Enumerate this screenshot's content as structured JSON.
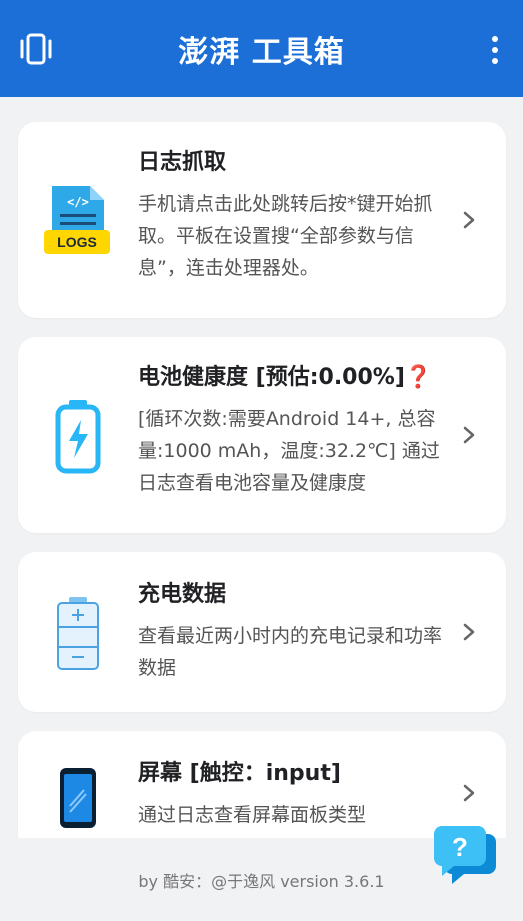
{
  "app": {
    "title": "澎湃 工具箱"
  },
  "cards": [
    {
      "title": "日志抓取",
      "description": "手机请点击此处跳转后按*键开始抓取。平板在设置搜“全部参数与信息”，连击处理器处。",
      "icon": "logs-file-icon",
      "icon_label": "LOGS"
    },
    {
      "title": "电池健康度 [预估:0.00%]❓",
      "description": "[循环次数:需要Android 14+, 总容量:1000 mAh，温度:32.2℃] 通过日志查看电池容量及健康度",
      "icon": "battery-charging-icon"
    },
    {
      "title": "充电数据",
      "description": "查看最近两小时内的充电记录和功率数据",
      "icon": "battery-plus-minus-icon"
    },
    {
      "title": "屏幕 [触控：input]",
      "description": "通过日志查看屏幕面板类型",
      "icon": "phone-screen-icon"
    }
  ],
  "footer": {
    "text": "by 酷安：@于逸风 version 3.6.1"
  },
  "colors": {
    "appbar": "#1b6fd6",
    "background": "#f1f2f4",
    "card": "#ffffff",
    "accent_cyan": "#29b6f6",
    "logs_yellow": "#ffd600"
  }
}
